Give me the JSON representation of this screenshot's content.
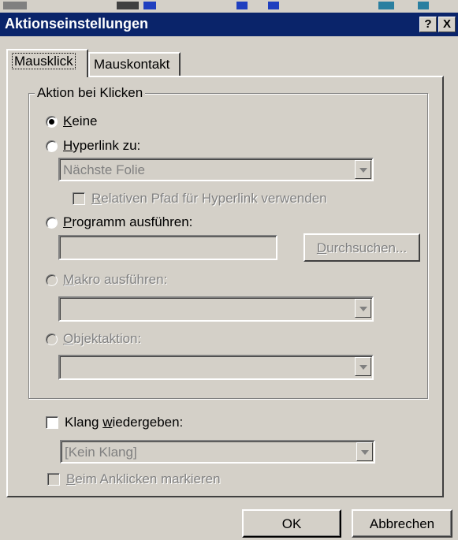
{
  "dialog": {
    "title": "Aktionseinstellungen",
    "help_button": "?",
    "close_button": "X"
  },
  "tabs": [
    {
      "label": "Mausklick",
      "active": true
    },
    {
      "label": "Mauskontakt",
      "active": false
    }
  ],
  "group": {
    "label": "Aktion bei Klicken"
  },
  "options": {
    "none": {
      "pre": "",
      "u": "K",
      "post": "eine",
      "selected": true
    },
    "hyperlink": {
      "pre": "",
      "u": "H",
      "post": "yperlink zu:",
      "selected": false
    },
    "hyperlink_value": "Nächste Folie",
    "relative_path": {
      "pre": "",
      "u": "R",
      "post": "elativen Pfad für Hyperlink verwenden",
      "checked": false
    },
    "program": {
      "pre": "",
      "u": "P",
      "post": "rogramm ausführen:",
      "selected": false
    },
    "program_value": "",
    "browse_button": {
      "pre": "",
      "u": "D",
      "post": "urchsuchen..."
    },
    "macro": {
      "pre": "",
      "u": "M",
      "post": "akro ausführen:",
      "selected": false
    },
    "macro_value": "",
    "object_action": {
      "pre": "",
      "u": "O",
      "post": "bjektaktion:",
      "selected": false
    },
    "object_action_value": ""
  },
  "sound": {
    "label": {
      "pre": "Klang ",
      "u": "w",
      "post": "iedergeben:"
    },
    "checked": false,
    "value": "[Kein Klang]"
  },
  "highlight": {
    "pre": "",
    "u": "B",
    "post": "eim Anklicken markieren",
    "checked": false
  },
  "buttons": {
    "ok": "OK",
    "cancel": "Abbrechen"
  },
  "colors": {
    "titlebar": "#0a246a",
    "face": "#d4d0c8",
    "disabled_text": "#808080"
  }
}
